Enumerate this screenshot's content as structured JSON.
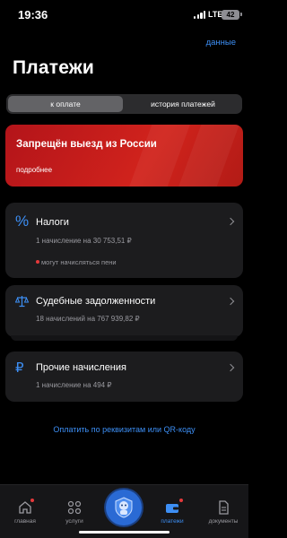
{
  "status_bar": {
    "time": "19:36",
    "network": "LTE",
    "battery": "42"
  },
  "header": {
    "data_link": "данные",
    "title": "Платежи"
  },
  "segments": {
    "active": "к оплате",
    "inactive": "история платежей"
  },
  "banner": {
    "title": "Запрещён выезд из России",
    "link": "подробнее",
    "color": "#c81e1b"
  },
  "cards": [
    {
      "title": "Налоги",
      "subtitle": "1 начисление на 30 753,51 ₽",
      "warning": "могут начисляться пени",
      "icon": "percent-icon"
    },
    {
      "title": "Судебные задолженности",
      "subtitle": "18 начислений на 767 939,82 ₽",
      "icon": "scales-icon"
    },
    {
      "title": "Прочие начисления",
      "subtitle": "1 начисление на 494 ₽",
      "icon": "ruble-icon"
    }
  ],
  "qr_link": "Оплатить по реквизитам или QR-коду",
  "tabbar": {
    "items": [
      {
        "label": "главная",
        "icon": "home-icon"
      },
      {
        "label": "услуги",
        "icon": "services-grid-icon"
      },
      {
        "label": "",
        "icon": "assistant-robot-icon"
      },
      {
        "label": "платежи",
        "icon": "wallet-icon",
        "active": true
      },
      {
        "label": "документы",
        "icon": "documents-icon"
      }
    ]
  },
  "colors": {
    "accent": "#3d8ff5",
    "alert": "#e5393b",
    "card": "#1c1c1e"
  }
}
